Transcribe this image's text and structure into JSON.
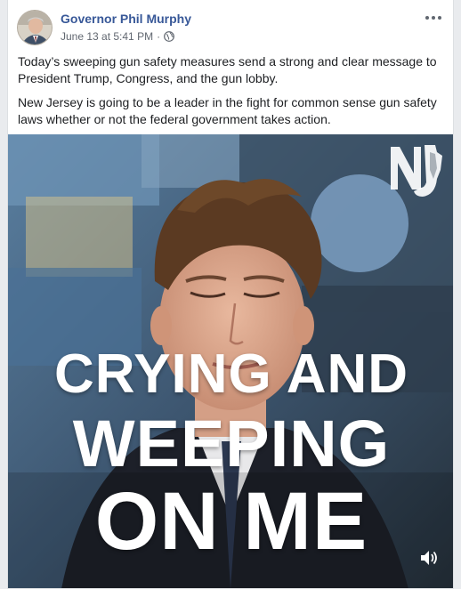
{
  "post": {
    "author": "Governor Phil Murphy",
    "date": "June 13 at 5:41 PM",
    "separator": "·",
    "privacy_icon": "globe-icon",
    "menu_icon": "more-options-icon",
    "paragraphs": [
      "Today’s sweeping gun safety measures send a strong and clear message to President Trump, Congress, and the gun lobby.",
      "New Jersey is going to be a leader in the fight for common sense gun safety laws whether or not the federal government takes action."
    ]
  },
  "video": {
    "caption_lines": [
      "CRYING AND",
      "WEEPING",
      "ON ME"
    ],
    "logo_text": "NJ",
    "sound_icon": "speaker-volume-icon"
  },
  "colors": {
    "author_link": "#385898",
    "meta": "#616770",
    "body_text": "#1c1e21",
    "card_border": "#dddfe2",
    "page_bg": "#e9ebee"
  }
}
